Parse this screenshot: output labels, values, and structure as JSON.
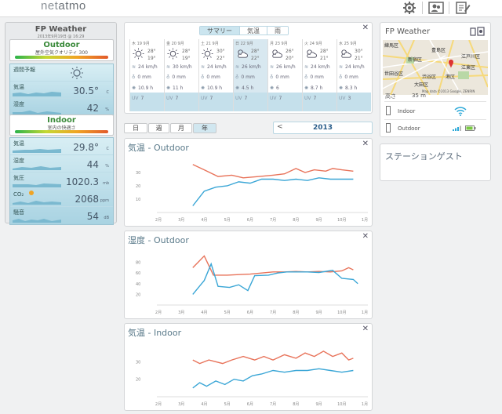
{
  "header": {
    "logo_net": "net",
    "logo_atmo": "atmo",
    "icons": [
      "gear-icon",
      "users-icon",
      "edit-icon"
    ]
  },
  "station": {
    "title": "FP Weather",
    "datetime": "2013年9月19日 @ 16:29",
    "outdoor": {
      "name": "Outdoor",
      "subtitle": "屋外空気クオリティ 300",
      "rows": [
        {
          "label": "週間予報",
          "value": "",
          "unit": "",
          "icon": "sun-icon"
        },
        {
          "label": "気温",
          "value": "30.5°",
          "unit": "C"
        },
        {
          "label": "湿度",
          "value": "42",
          "unit": "%"
        }
      ]
    },
    "indoor": {
      "name": "Indoor",
      "subtitle": "室内の快適さ",
      "rows": [
        {
          "label": "気温",
          "value": "29.8°",
          "unit": "C"
        },
        {
          "label": "湿度",
          "value": "44",
          "unit": "%"
        },
        {
          "label": "気圧",
          "value": "1020.3",
          "unit": "mb"
        },
        {
          "label": "CO₂",
          "value": "2068",
          "unit": "ppm"
        },
        {
          "label": "騒音",
          "value": "54",
          "unit": "dB"
        }
      ]
    }
  },
  "forecast": {
    "tabs": [
      "サマリー",
      "気温",
      "雨"
    ],
    "active_tab": 0,
    "days": [
      {
        "date": "木 19 9月",
        "hi": "28°",
        "lo": "19°",
        "wind": "24 km/h",
        "rain": "0 mm",
        "sun": "10.9 h",
        "uv": "7",
        "icon": "sun-icon"
      },
      {
        "date": "金 20 9月",
        "hi": "28°",
        "lo": "19°",
        "wind": "30 km/h",
        "rain": "0 mm",
        "sun": "11 h",
        "uv": "7",
        "icon": "sun-icon"
      },
      {
        "date": "土 21 9月",
        "hi": "30°",
        "lo": "22°",
        "wind": "24 km/h",
        "rain": "0 mm",
        "sun": "10.9 h",
        "uv": "7",
        "icon": "sun-icon"
      },
      {
        "date": "日 22 9月",
        "hi": "28°",
        "lo": "22°",
        "wind": "26 km/h",
        "rain": "0 mm",
        "sun": "4.5 h",
        "uv": "7",
        "icon": "partly-cloudy-icon"
      },
      {
        "date": "月 23 9月",
        "hi": "26°",
        "lo": "20°",
        "wind": "26 km/h",
        "rain": "0 mm",
        "sun": "6",
        "uv": "7",
        "icon": "partly-cloudy-icon"
      },
      {
        "date": "火 24 9月",
        "hi": "28°",
        "lo": "21°",
        "wind": "24 km/h",
        "rain": "0 mm",
        "sun": "8.7 h",
        "uv": "7",
        "icon": "partly-cloudy-icon"
      },
      {
        "date": "水 25 9月",
        "hi": "30°",
        "lo": "21°",
        "wind": "24 km/h",
        "rain": "0 mm",
        "sun": "8.3 h",
        "uv": "3",
        "icon": "partly-cloudy-icon"
      }
    ]
  },
  "period": {
    "buttons": [
      "日",
      "週",
      "月",
      "年"
    ],
    "active": 3,
    "year": "2013",
    "prev": "<"
  },
  "chart_data": [
    {
      "type": "line",
      "title": "気温",
      "subtitle": "Outdoor",
      "x_ticks": [
        "2月",
        "3月",
        "4月",
        "5月",
        "6月",
        "7月",
        "8月",
        "9月",
        "10月",
        "1月"
      ],
      "y_ticks": [
        10,
        20,
        30
      ],
      "ylim": [
        0,
        40
      ],
      "series": [
        {
          "color": "#e8735a",
          "points": [
            [
              3.5,
              36
            ],
            [
              4,
              32
            ],
            [
              4.6,
              27
            ],
            [
              5.2,
              28
            ],
            [
              5.7,
              26
            ],
            [
              6.4,
              27
            ],
            [
              7,
              28
            ],
            [
              7.5,
              29
            ],
            [
              8,
              33
            ],
            [
              8.4,
              30
            ],
            [
              8.8,
              32
            ],
            [
              9.3,
              31
            ],
            [
              9.6,
              33
            ],
            [
              10,
              32
            ],
            [
              10.5,
              31
            ]
          ]
        },
        {
          "color": "#3aa6d6",
          "points": [
            [
              3.5,
              5
            ],
            [
              4,
              16
            ],
            [
              4.5,
              19
            ],
            [
              5,
              20
            ],
            [
              5.5,
              23
            ],
            [
              6,
              22
            ],
            [
              6.5,
              25
            ],
            [
              7,
              25
            ],
            [
              7.5,
              24
            ],
            [
              8,
              25
            ],
            [
              8.5,
              24
            ],
            [
              9,
              26
            ],
            [
              9.5,
              25
            ],
            [
              10,
              25
            ],
            [
              10.5,
              25
            ]
          ]
        }
      ]
    },
    {
      "type": "line",
      "title": "湿度",
      "subtitle": "Outdoor",
      "x_ticks": [
        "2月",
        "3月",
        "4月",
        "5月",
        "6月",
        "7月",
        "8月",
        "9月",
        "10月",
        "1月"
      ],
      "y_ticks": [
        20,
        40,
        60,
        80
      ],
      "ylim": [
        0,
        100
      ],
      "series": [
        {
          "color": "#e8735a",
          "points": [
            [
              3.5,
              70
            ],
            [
              4,
              92
            ],
            [
              4.4,
              56
            ],
            [
              5,
              56
            ],
            [
              5.5,
              57
            ],
            [
              6,
              58
            ],
            [
              6.5,
              60
            ],
            [
              7,
              62
            ],
            [
              7.5,
              62
            ],
            [
              8,
              63
            ],
            [
              8.5,
              62
            ],
            [
              9,
              63
            ],
            [
              9.5,
              62
            ],
            [
              10,
              64
            ],
            [
              10.3,
              70
            ],
            [
              10.5,
              66
            ]
          ]
        },
        {
          "color": "#3aa6d6",
          "points": [
            [
              3.5,
              20
            ],
            [
              4,
              46
            ],
            [
              4.3,
              77
            ],
            [
              4.6,
              35
            ],
            [
              5.1,
              33
            ],
            [
              5.5,
              38
            ],
            [
              5.9,
              27
            ],
            [
              6.2,
              55
            ],
            [
              6.8,
              56
            ],
            [
              7.2,
              60
            ],
            [
              7.6,
              62
            ],
            [
              8,
              62
            ],
            [
              8.5,
              62
            ],
            [
              9,
              61
            ],
            [
              9.6,
              65
            ],
            [
              10,
              50
            ],
            [
              10.5,
              48
            ],
            [
              10.7,
              40
            ]
          ]
        }
      ]
    },
    {
      "type": "line",
      "title": "気温",
      "subtitle": "Indoor",
      "x_ticks": [
        "2月",
        "3月",
        "4月",
        "5月",
        "6月",
        "7月",
        "8月",
        "9月",
        "10月",
        "1月"
      ],
      "y_ticks": [
        20,
        30
      ],
      "ylim": [
        10,
        40
      ],
      "series": [
        {
          "color": "#e8735a",
          "points": [
            [
              3.5,
              31
            ],
            [
              3.8,
              29
            ],
            [
              4.2,
              31
            ],
            [
              4.8,
              29
            ],
            [
              5.2,
              31
            ],
            [
              5.7,
              33
            ],
            [
              6.2,
              31
            ],
            [
              6.6,
              33
            ],
            [
              7,
              31
            ],
            [
              7.5,
              34
            ],
            [
              8,
              32
            ],
            [
              8.4,
              35
            ],
            [
              8.8,
              33
            ],
            [
              9.2,
              36
            ],
            [
              9.6,
              33
            ],
            [
              10,
              35
            ],
            [
              10.3,
              31
            ],
            [
              10.5,
              32
            ]
          ]
        },
        {
          "color": "#3aa6d6",
          "points": [
            [
              3.5,
              15
            ],
            [
              3.8,
              18
            ],
            [
              4.1,
              16
            ],
            [
              4.5,
              19
            ],
            [
              4.9,
              17
            ],
            [
              5.3,
              20
            ],
            [
              5.7,
              19
            ],
            [
              6.1,
              22
            ],
            [
              6.5,
              23
            ],
            [
              7,
              25
            ],
            [
              7.5,
              24
            ],
            [
              8,
              25
            ],
            [
              8.5,
              25
            ],
            [
              9,
              26
            ],
            [
              9.5,
              25
            ],
            [
              10,
              24
            ],
            [
              10.5,
              25
            ]
          ]
        }
      ]
    }
  ],
  "fpweather": {
    "title": "FP Weather",
    "altitude_label": "高さ",
    "altitude": "35 m",
    "modules": [
      "Indoor",
      "Outdoor"
    ],
    "map_labels": [
      "練馬区",
      "豊島区",
      "江戸川区",
      "新宿区",
      "江東区",
      "世田谷区",
      "渋谷区",
      "港区",
      "大田区"
    ],
    "map_credit": "Map data ©2013 Google, ZENRIN"
  },
  "guest": {
    "title": "ステーションゲスト"
  }
}
